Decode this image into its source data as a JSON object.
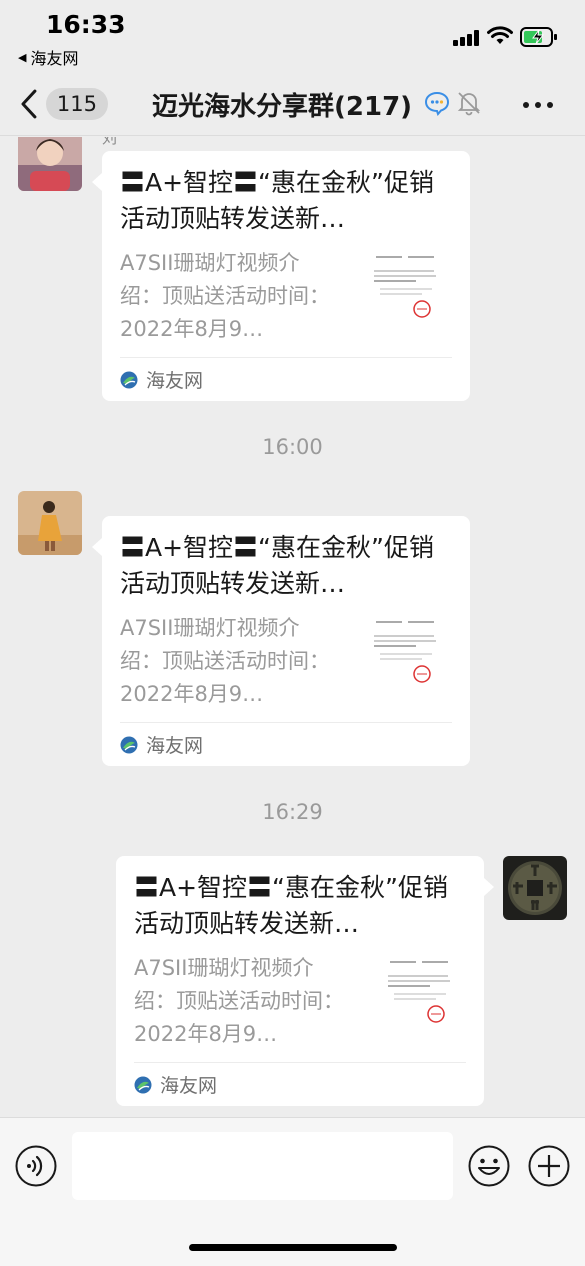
{
  "status_bar": {
    "time": "16:33",
    "back_app": "海友网",
    "colors": {
      "battery_fill": "#34c759"
    }
  },
  "nav": {
    "unread_count": "115",
    "title": "迈光海水分享群",
    "member_count": "(217)",
    "icons": [
      "chevron-left-icon",
      "chat-bubble-icon",
      "mute-bell-icon",
      "more-dots-icon"
    ]
  },
  "chat": {
    "partial_sender": "刘",
    "timestamps": [
      "16:00",
      "16:29"
    ],
    "messages": [
      {
        "side": "left",
        "title": "〓A+智控〓“惠在金秋”促销活动顶贴转发送新…",
        "description": "A7SII珊瑚灯视频介绍：顶贴送活动时间：2022年8月9…",
        "source": "海友网"
      },
      {
        "side": "left",
        "title": "〓A+智控〓“惠在金秋”促销活动顶贴转发送新…",
        "description": "A7SII珊瑚灯视频介绍：顶贴送活动时间：2022年8月9…",
        "source": "海友网"
      },
      {
        "side": "right",
        "title": "〓A+智控〓“惠在金秋”促销活动顶贴转发送新…",
        "description": "A7SII珊瑚灯视频介绍：顶贴送活动时间：2022年8月9…",
        "source": "海友网"
      }
    ]
  },
  "input_bar": {
    "icons": [
      "voice-icon",
      "emoji-icon",
      "plus-icon"
    ],
    "text_value": ""
  },
  "colors": {
    "background": "#ededed",
    "card": "#ffffff",
    "source_green": "#07c160"
  }
}
